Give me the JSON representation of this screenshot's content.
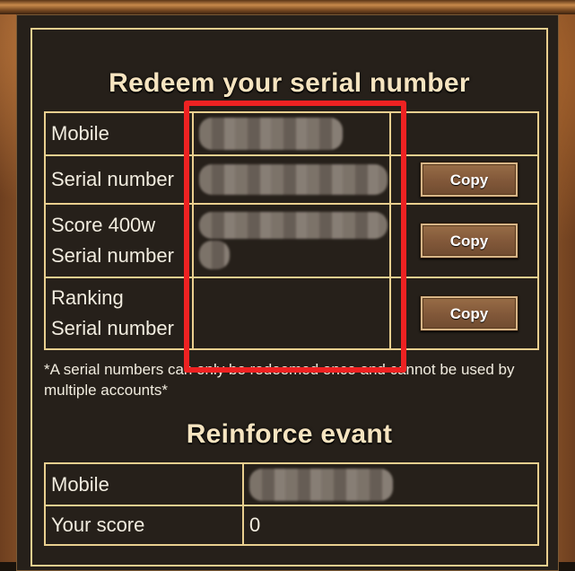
{
  "redeem": {
    "title": "Redeem your serial number",
    "rows": [
      {
        "label_line1": "Mobile",
        "label_line2": "",
        "value": "",
        "has_copy": false
      },
      {
        "label_line1": "Serial number",
        "label_line2": "",
        "value": "",
        "has_copy": true
      },
      {
        "label_line1": "Score 400w",
        "label_line2": "Serial number",
        "value": "",
        "has_copy": true
      },
      {
        "label_line1": "Ranking",
        "label_line2": "Serial number",
        "value": "",
        "has_copy": true
      }
    ],
    "copy_label": "Copy",
    "note": "*A serial numbers can only be redeemed once and cannot be used by multiple accounts*"
  },
  "reinforce": {
    "title": "Reinforce evant",
    "rows": [
      {
        "label": "Mobile",
        "value": ""
      },
      {
        "label": "Your score",
        "value": "0"
      }
    ]
  },
  "colors": {
    "border": "#e9cf8f",
    "highlight": "#ee2222",
    "panel": "#26201a"
  }
}
